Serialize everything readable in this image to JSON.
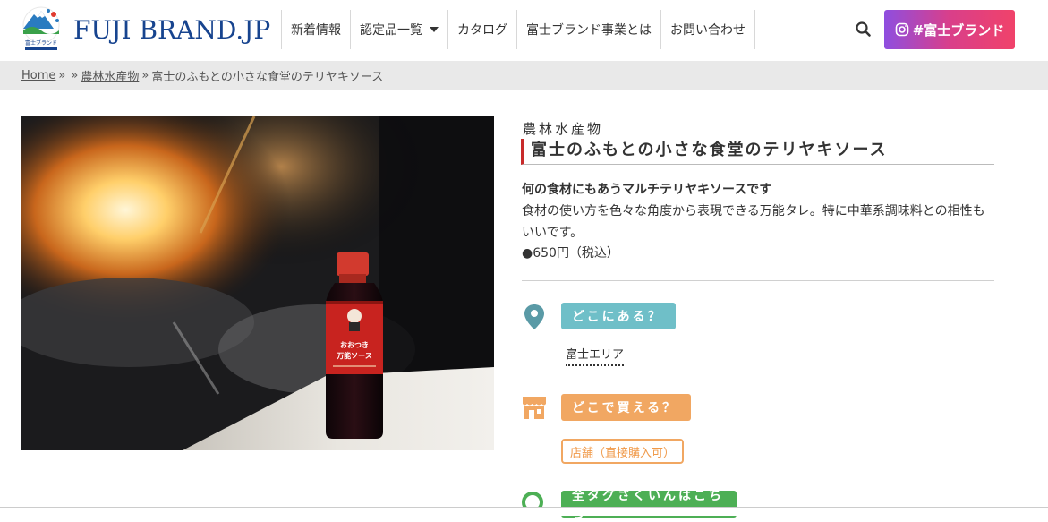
{
  "header": {
    "brand_mark_text": "富士ブランド",
    "brand_name": "FUJI BRAND.JP",
    "nav": [
      {
        "label": "新着情報"
      },
      {
        "label": "認定品一覧"
      },
      {
        "label": "カタログ"
      },
      {
        "label": "富士ブランド事業とは"
      },
      {
        "label": "お問い合わせ"
      }
    ],
    "instagram_label": "#富士ブランド"
  },
  "breadcrumb": {
    "home": "Home",
    "sep1": "»",
    "sep2": "»",
    "category": "農林水産物",
    "sep3": "»",
    "current": "富士のふもとの小さな食堂のテリヤキソース"
  },
  "product": {
    "category": "農林水産物",
    "title": "富士のふもとの小さな食堂のテリヤキソース",
    "lead": "何の食材にもあうマルチテリヤキソースです",
    "description": "食材の使い方を色々な角度から表現できる万能タレ。特に中華系調味料との相性もいいです。",
    "price": "●650円（税込）",
    "bottle_label": "おおつき万能ソース"
  },
  "info": {
    "where_label": "どこにある？",
    "where_value": "富士エリア",
    "buy_label": "どこで買える？",
    "buy_value": "店舗（直接購入可）",
    "tag_label": "全タグさくいんはこちら"
  },
  "colors": {
    "brand_blue": "#17448f",
    "title_accent": "#c82a2a",
    "where_teal": "#6fbfc8",
    "buy_orange": "#f1a762",
    "tag_green": "#4daf55"
  }
}
